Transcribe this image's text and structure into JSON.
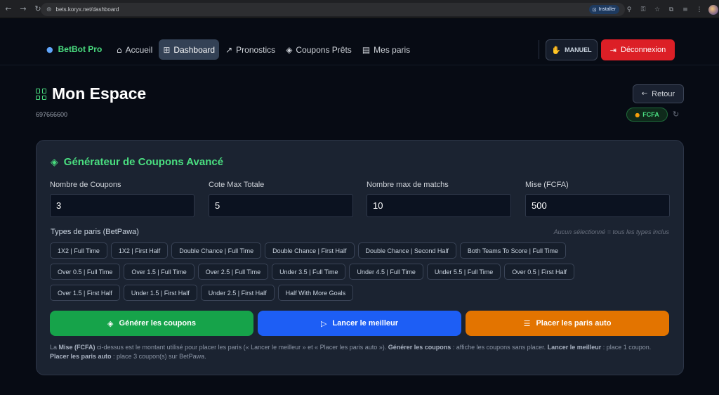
{
  "browser": {
    "url": "bets.koryx.net/dashboard",
    "install_label": "Installer"
  },
  "header": {
    "brand": "BetBot Pro",
    "nav": [
      {
        "label": "Accueil",
        "icon": "home-icon"
      },
      {
        "label": "Dashboard",
        "icon": "grid-icon",
        "active": true
      },
      {
        "label": "Pronostics",
        "icon": "trend-icon"
      },
      {
        "label": "Coupons Prêts",
        "icon": "layers-icon"
      },
      {
        "label": "Mes paris",
        "icon": "receipt-icon"
      }
    ],
    "manual_label": "MANUEL",
    "logout_label": "Déconnexion"
  },
  "page": {
    "title": "Mon Espace",
    "user_id": "697666600",
    "back_label": "Retour",
    "currency": "FCFA"
  },
  "generator": {
    "title": "Générateur de Coupons Avancé",
    "fields": [
      {
        "label": "Nombre de Coupons",
        "value": "3"
      },
      {
        "label": "Cote Max Totale",
        "value": "5"
      },
      {
        "label": "Nombre max de matchs",
        "value": "10"
      },
      {
        "label": "Mise (FCFA)",
        "value": "500"
      }
    ],
    "types_label": "Types de paris (BetPawa)",
    "types_note": "Aucun sélectionné = tous les types inclus",
    "bet_types": [
      [
        "1X2 | Full Time",
        "1X2 | First Half",
        "Double Chance | Full Time",
        "Double Chance | First Half",
        "Double Chance | Second Half",
        "Both Teams To Score | Full Time"
      ],
      [
        "Over 0.5 | Full Time",
        "Over 1.5 | Full Time",
        "Over 2.5 | Full Time",
        "Under 3.5 | Full Time",
        "Under 4.5 | Full Time",
        "Under 5.5 | Full Time",
        "Over 0.5 | First Half"
      ],
      [
        "Over 1.5 | First Half",
        "Under 1.5 | First Half",
        "Under 2.5 | First Half",
        "Half With More Goals"
      ]
    ],
    "actions": {
      "generate": "Générer les coupons",
      "launch_best": "Lancer le meilleur",
      "place_auto": "Placer les paris auto"
    },
    "help": {
      "t1": "La ",
      "b1": "Mise (FCFA)",
      "t2": " ci-dessus est le montant utilisé pour placer les paris (« Lancer le meilleur » et « Placer les paris auto »). ",
      "b2": "Générer les coupons",
      "t3": " : affiche les coupons sans placer. ",
      "b3": "Lancer le meilleur",
      "t4": " : place 1 coupon. ",
      "b4": "Placer les paris auto",
      "t5": " : place 3 coupon(s) sur BetPawa."
    }
  },
  "colors": {
    "accent_green": "#4ade80",
    "logout_red": "#dc1f26",
    "generate_green": "#16a34a",
    "launch_blue": "#1d5ef5",
    "place_orange": "#e37400"
  }
}
